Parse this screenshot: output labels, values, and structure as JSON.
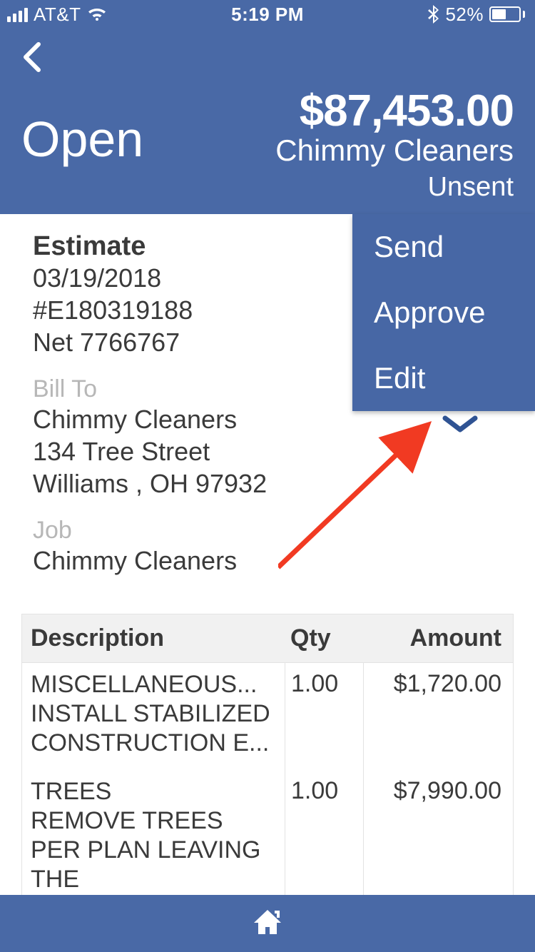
{
  "status_bar": {
    "carrier": "AT&T",
    "time": "5:19 PM",
    "battery_pct": "52%",
    "battery_fill": 52
  },
  "header": {
    "status_label": "Open",
    "total": "$87,453.00",
    "customer": "Chimmy Cleaners",
    "sent_status": "Unsent"
  },
  "actions": {
    "send": "Send",
    "approve": "Approve",
    "edit": "Edit"
  },
  "estimate": {
    "title": "Estimate",
    "date": "03/19/2018",
    "number": "#E180319188",
    "net": "Net 7766767"
  },
  "bill_to": {
    "label": "Bill To",
    "name": "Chimmy Cleaners",
    "street": "134 Tree Street",
    "city_line": "Williams , OH 97932"
  },
  "job": {
    "label": "Job",
    "name": "Chimmy Cleaners"
  },
  "table": {
    "headers": {
      "desc": "Description",
      "qty": "Qty",
      "amount": "Amount"
    },
    "rows": [
      {
        "title": "MISCELLANEOUS...",
        "sub": "INSTALL STABILIZED CONSTRUCTION E...",
        "qty": "1.00",
        "amount": "$1,720.00"
      },
      {
        "title": "TREES",
        "sub": "REMOVE TREES PER PLAN LEAVING THE",
        "qty": "1.00",
        "amount": "$7,990.00"
      }
    ]
  },
  "colors": {
    "primary": "#4969a6",
    "panel": "#4767a5",
    "muted": "#b7b7b7",
    "text": "#3a3a3a",
    "annotation": "#f13a22"
  }
}
